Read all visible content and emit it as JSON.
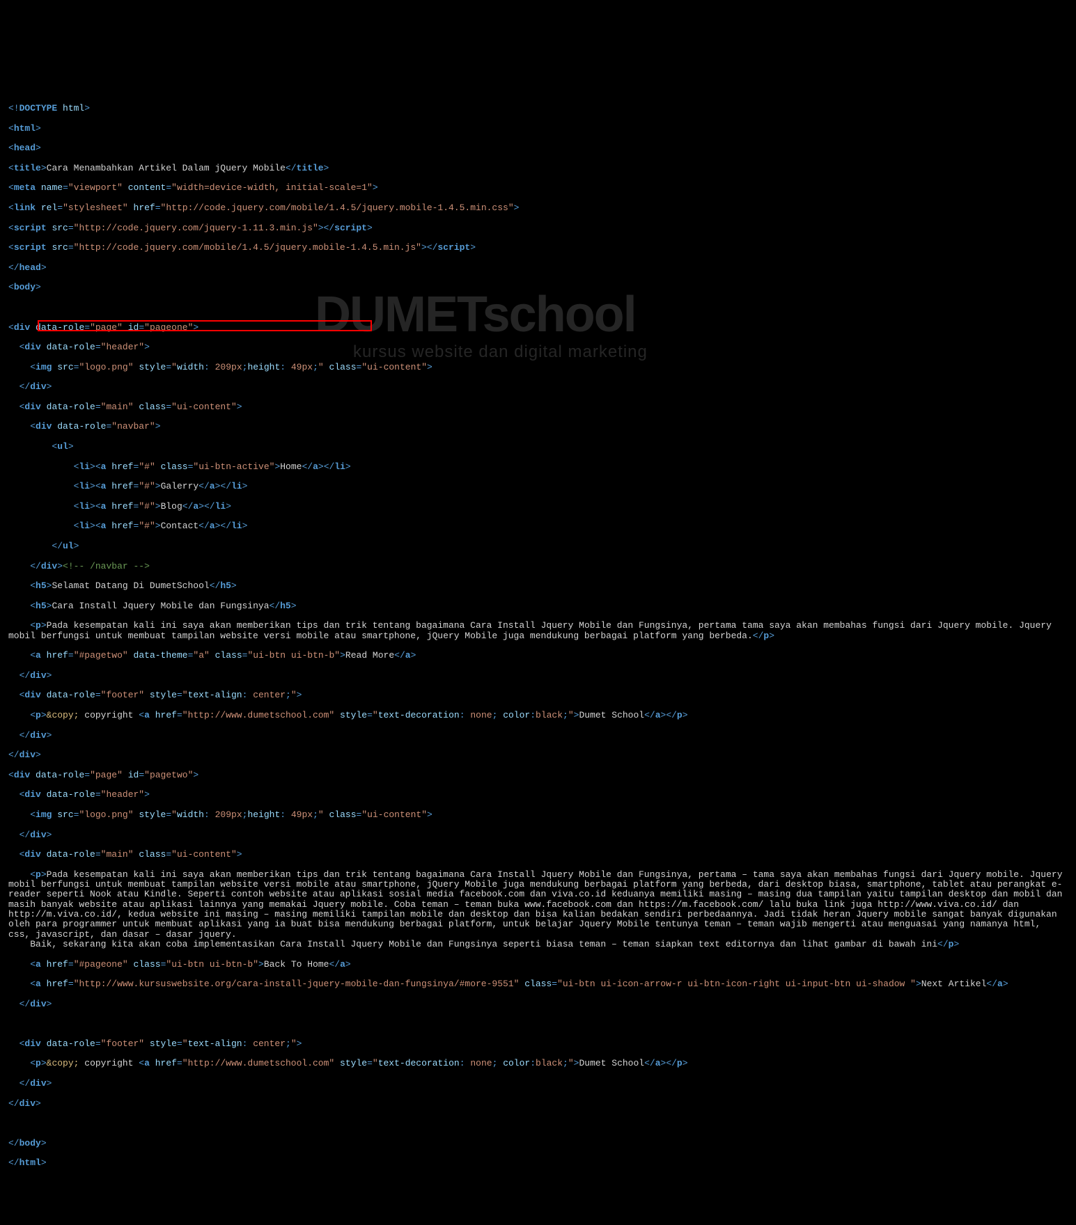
{
  "watermark": {
    "line1": "DUMETschool",
    "line2": "kursus website dan digital marketing"
  },
  "code": {
    "doctype": "<!DOCTYPE html>",
    "title_text": "Cara Menambahkan Artikel Dalam jQuery Mobile",
    "meta_name": "viewport",
    "meta_content": "width=device-width, initial-scale=1",
    "link_rel": "stylesheet",
    "link_href": "http://code.jquery.com/mobile/1.4.5/jquery.mobile-1.4.5.min.css",
    "script1_src": "http://code.jquery.com/jquery-1.11.3.min.js",
    "script2_src": "http://code.jquery.com/mobile/1.4.5/jquery.mobile-1.4.5.min.js",
    "page1_id": "pageone",
    "page2_id": "pagetwo",
    "data_role_page": "page",
    "data_role_header": "header",
    "data_role_main": "main",
    "data_role_navbar": "navbar",
    "data_role_footer": "footer",
    "logo_src": "logo.png",
    "logo_style": "width: 209px;height: 49px;",
    "ui_content": "ui-content",
    "nav": {
      "home": "Home",
      "galerry": "Galerry",
      "blog": "Blog",
      "contact": "Contact"
    },
    "ui_btn_active": "ui-btn-active",
    "navbar_comment": " /navbar ",
    "h5_1": "Selamat Datang Di DumetSchool",
    "h5_2": "Cara Install Jquery Mobile dan Fungsinya",
    "p1": "Pada kesempatan kali ini saya akan memberikan tips dan trik tentang bagaimana Cara Install Jquery Mobile dan Fungsinya, pertama tama saya akan membahas fungsi dari Jquery mobile. Jquery mobil berfungsi untuk membuat tampilan website versi mobile atau smartphone, jQuery Mobile juga mendukung berbagai platform yang berbeda.",
    "readmore_href": "#pagetwo",
    "readmore_theme": "a",
    "readmore_class": "ui-btn ui-btn-b",
    "readmore_text": "Read More",
    "footer_style": "text-align: center;",
    "copy_entity": "&copy;",
    "copyright_text": " copyright ",
    "dumet_href": "http://www.dumetschool.com",
    "dumet_style_none": "text-decoration: none; color:black;",
    "dumet_text": "Dumet School",
    "p2_full": "Pada kesempatan kali ini saya akan memberikan tips dan trik tentang bagaimana Cara Install Jquery Mobile dan Fungsinya, pertama – tama saya akan membahas fungsi dari Jquery mobile. Jquery mobil berfungsi untuk membuat tampilan website versi mobile atau smartphone, jQuery Mobile juga mendukung berbagai platform yang berbeda, dari desktop biasa, smartphone, tablet atau perangkat e-reader seperti Nook atau Kindle. Seperti contoh website atau aplikasi sosial media facebook.com dan viva.co.id keduanya memiliki masing – masing dua tampilan yaitu tampilan desktop dan mobil dan masih banyak website atau aplikasi lainnya yang memakai Jquery mobile. Coba teman – teman buka www.facebook.com dan https://m.facebook.com/ lalu buka link juga http://www.viva.co.id/ dan http://m.viva.co.id/, kedua website ini masing – masing memiliki tampilan mobile dan desktop dan bisa kalian bedakan sendiri perbedaannya. Jadi tidak heran Jquery mobile sangat banyak digunakan oleh para programmer untuk membuat aplikasi yang ia buat bisa mendukung berbagai platform, untuk belajar Jquery Mobile tentunya teman – teman wajib mengerti atau menguasai yang namanya html, css, javascript, dan dasar – dasar jquery.",
    "p2_line2": "Baik, sekarang kita akan coba implementasikan Cara Install Jquery Mobile dan Fungsinya seperti biasa teman – teman siapkan text editornya dan lihat gambar di bawah ini",
    "back_home_href": "#pageone",
    "back_home_class": "ui-btn ui-btn-b",
    "back_home_text": "Back To Home",
    "next_href": "http://www.kursuswebsite.org/cara-install-jquery-mobile-dan-fungsinya/#more-9551",
    "next_class": "ui-btn ui-icon-arrow-r ui-btn-icon-right ui-input-btn ui-shadow ",
    "next_text": "Next Artikel",
    "hash": "#"
  }
}
